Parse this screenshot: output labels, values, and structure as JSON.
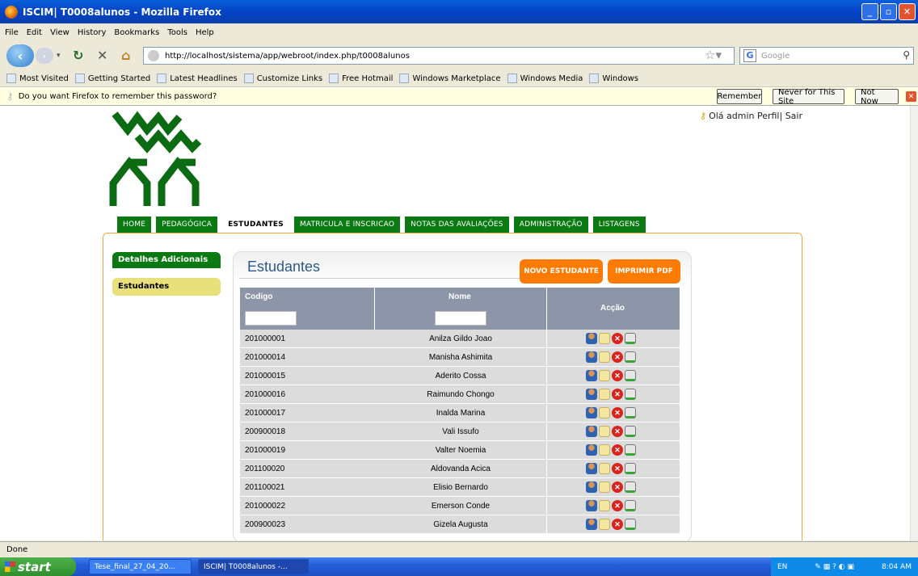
{
  "window": {
    "title": "ISCIM| T0008alunos - Mozilla Firefox"
  },
  "menu": [
    "File",
    "Edit",
    "View",
    "History",
    "Bookmarks",
    "Tools",
    "Help"
  ],
  "url": "http://localhost/sistema/app/webroot/index.php/t0008alunos",
  "search": {
    "placeholder": "Google"
  },
  "bookmarks": [
    "Most Visited",
    "Getting Started",
    "Latest Headlines",
    "Customize Links",
    "Free Hotmail",
    "Windows Marketplace",
    "Windows Media",
    "Windows"
  ],
  "notification": {
    "text": "Do you want Firefox to remember this password?",
    "remember": "Remember",
    "never": "Never for This Site",
    "notnow": "Not Now"
  },
  "user": {
    "text": "Olá admin Perfil| Sair"
  },
  "tabs": [
    "HOME",
    "PEDAGÓGICA",
    "ESTUDANTES",
    "MATRICULA E INSCRICAO",
    "NOTAS DAS AVALIAÇÕES",
    "ADMINISTRAÇÃO",
    "LISTAGENS"
  ],
  "sidebar": {
    "details": "Detalhes Adicionais",
    "students": "Estudantes"
  },
  "panel": {
    "title": "Estudantes",
    "new_btn": "NOVO ESTUDANTE",
    "pdf_btn": "IMPRIMIR PDF"
  },
  "table": {
    "headers": {
      "codigo": "Codigo",
      "nome": "Nome",
      "accao": "Acção"
    },
    "rows": [
      {
        "codigo": "201000001",
        "nome": "Anilza Gildo Joao"
      },
      {
        "codigo": "201000014",
        "nome": "Manisha Ashimita"
      },
      {
        "codigo": "201000015",
        "nome": "Aderito Cossa"
      },
      {
        "codigo": "201000016",
        "nome": "Raimundo Chongo"
      },
      {
        "codigo": "201000017",
        "nome": "Inalda Marina"
      },
      {
        "codigo": "200900018",
        "nome": "Vali Issufo"
      },
      {
        "codigo": "201000019",
        "nome": "Valter Noemia"
      },
      {
        "codigo": "201100020",
        "nome": "Aldovanda Acica"
      },
      {
        "codigo": "201100021",
        "nome": "Elisio Bernardo"
      },
      {
        "codigo": "201000022",
        "nome": "Emerson Conde"
      },
      {
        "codigo": "200900023",
        "nome": "Gizela Augusta"
      }
    ]
  },
  "status": "Done",
  "taskbar": {
    "start": "start",
    "task1": "Tese_final_27_04_20...",
    "task2": "ISCIM| T0008alunos -...",
    "lang": "EN",
    "clock": "8:04 AM"
  }
}
